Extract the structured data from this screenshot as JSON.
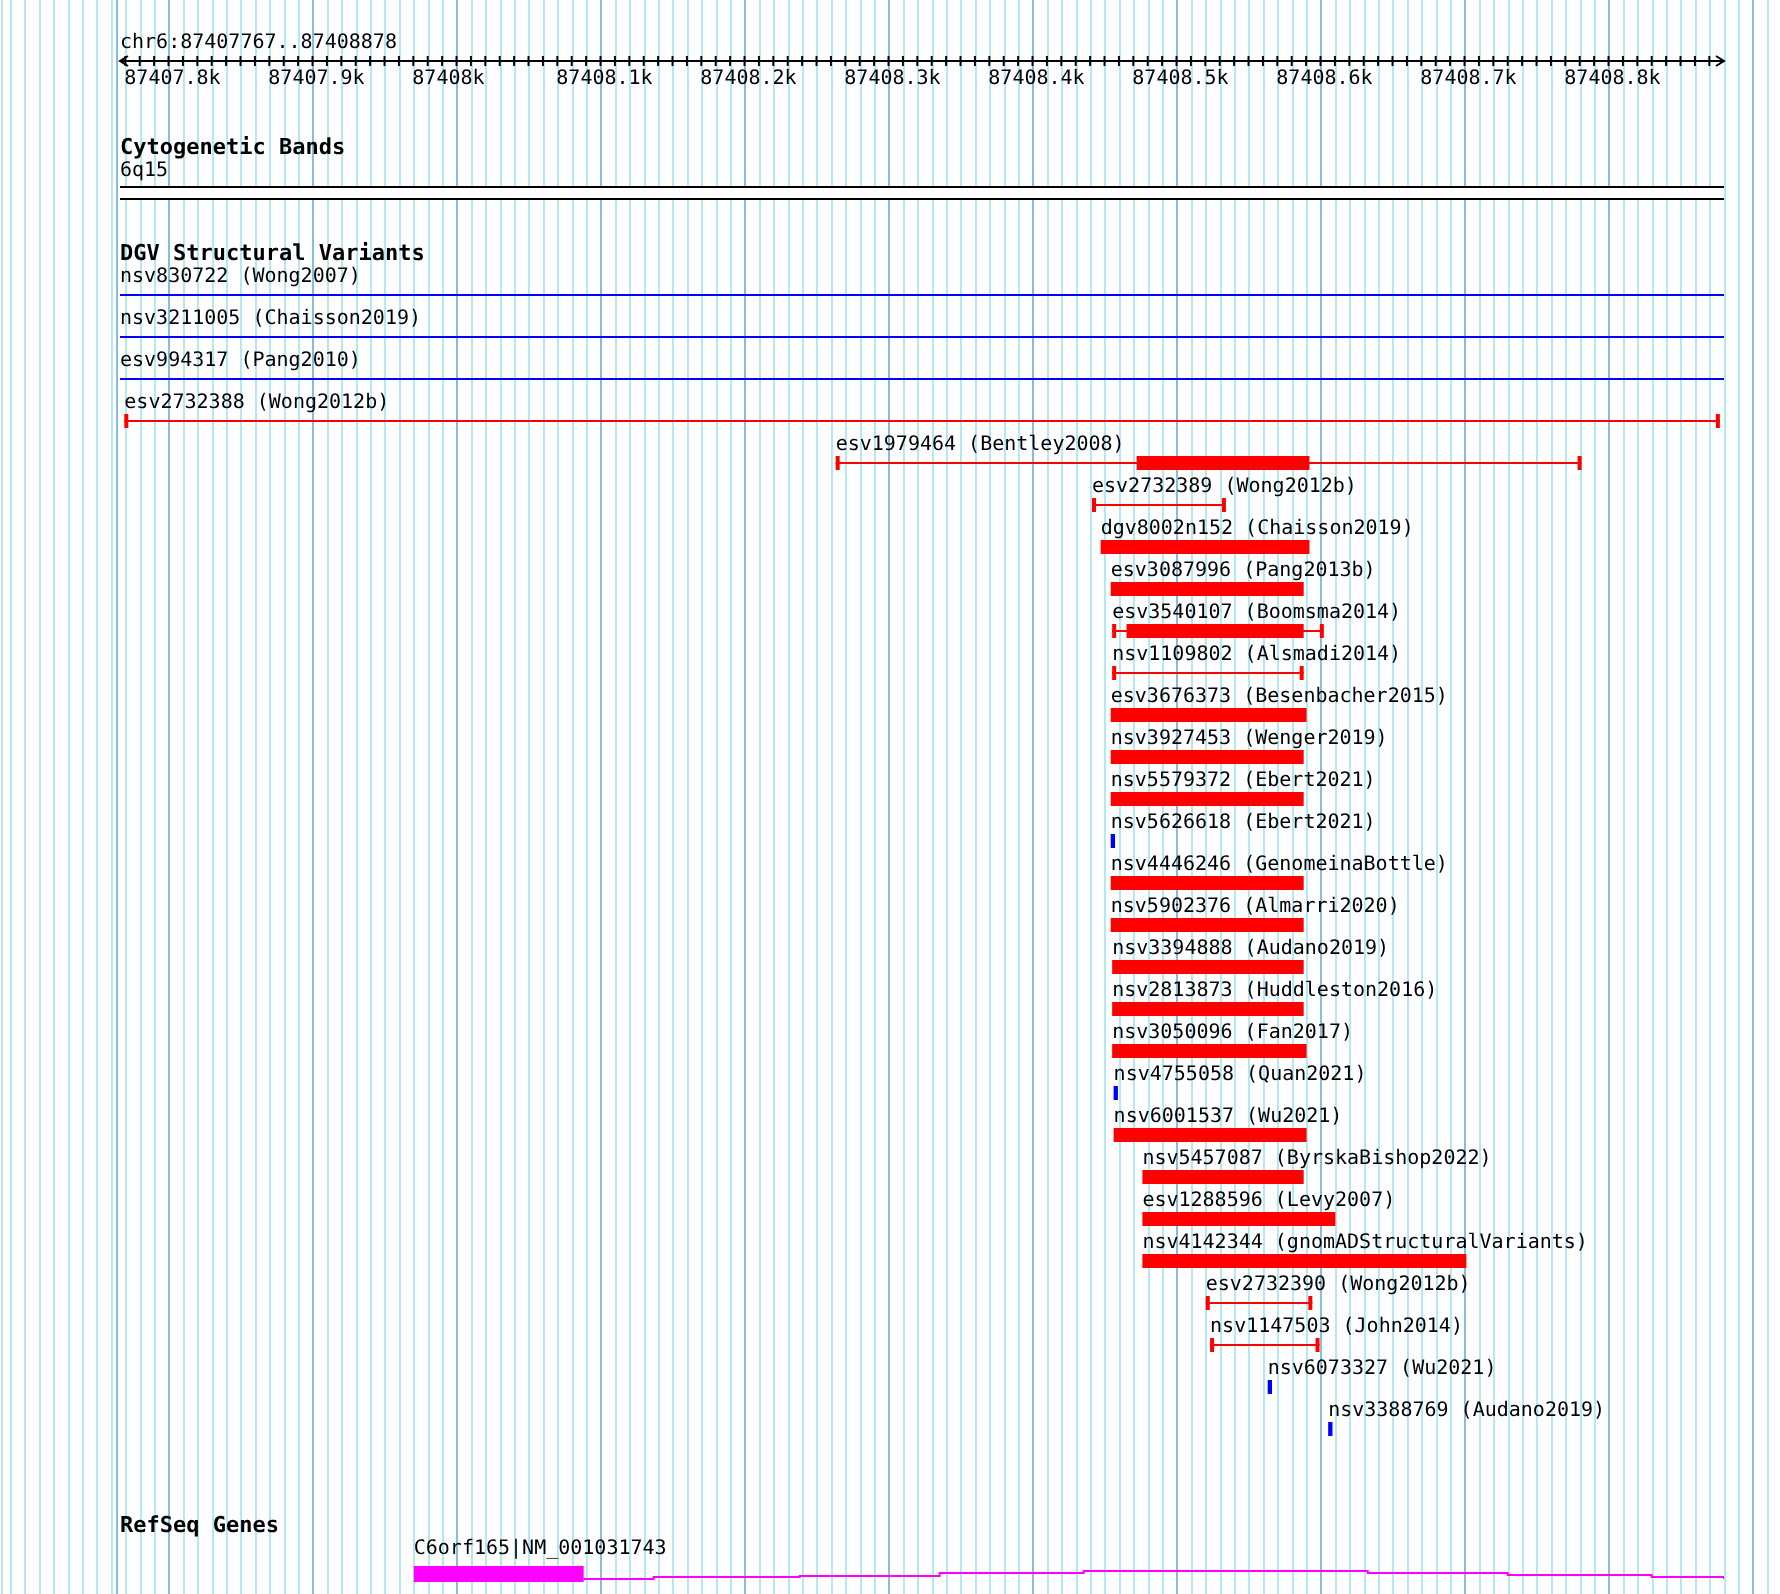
{
  "ruler": {
    "region": "chr6:87407767..87408878",
    "ticks": [
      "87407.8k",
      "87407.9k",
      "87408k",
      "87408.1k",
      "87408.2k",
      "87408.3k",
      "87408.4k",
      "87408.5k",
      "87408.6k",
      "87408.7k",
      "87408.8k"
    ]
  },
  "cytogenetic_bands": {
    "title": "Cytogenetic Bands",
    "band": "6q15"
  },
  "structural_variants": {
    "title": "DGV Structural Variants",
    "features": [
      {
        "label": "nsv830722 (Wong2007)",
        "kind": "line",
        "color": "#0000ff"
      },
      {
        "label": "nsv3211005 (Chaisson2019)",
        "kind": "line",
        "color": "#0000ff"
      },
      {
        "label": "esv994317 (Pang2010)",
        "kind": "line",
        "color": "#0000ff"
      },
      {
        "label": "esv2732388 (Wong2012b)",
        "kind": "capped",
        "color": "#ff0000"
      },
      {
        "label": "esv1979464 (Bentley2008)",
        "kind": "capped_bar",
        "color": "#ff0000"
      },
      {
        "label": "esv2732389 (Wong2012b)",
        "kind": "capped",
        "color": "#ff0000"
      },
      {
        "label": "dgv8002n152 (Chaisson2019)",
        "kind": "bar",
        "color": "#ff0000"
      },
      {
        "label": "esv3087996 (Pang2013b)",
        "kind": "bar",
        "color": "#ff0000"
      },
      {
        "label": "esv3540107 (Boomsma2014)",
        "kind": "capped_bar",
        "color": "#ff0000"
      },
      {
        "label": "nsv1109802 (Alsmadi2014)",
        "kind": "capped",
        "color": "#ff0000"
      },
      {
        "label": "esv3676373 (Besenbacher2015)",
        "kind": "bar",
        "color": "#ff0000"
      },
      {
        "label": "nsv3927453 (Wenger2019)",
        "kind": "bar",
        "color": "#ff0000"
      },
      {
        "label": "nsv5579372 (Ebert2021)",
        "kind": "bar",
        "color": "#ff0000"
      },
      {
        "label": "nsv5626618 (Ebert2021)",
        "kind": "point",
        "color": "#0000ff"
      },
      {
        "label": "nsv4446246 (GenomeinaBottle)",
        "kind": "bar",
        "color": "#ff0000"
      },
      {
        "label": "nsv5902376 (Almarri2020)",
        "kind": "bar",
        "color": "#ff0000"
      },
      {
        "label": "nsv3394888 (Audano2019)",
        "kind": "bar",
        "color": "#ff0000"
      },
      {
        "label": "nsv2813873 (Huddleston2016)",
        "kind": "bar",
        "color": "#ff0000"
      },
      {
        "label": "nsv3050096 (Fan2017)",
        "kind": "bar",
        "color": "#ff0000"
      },
      {
        "label": "nsv4755058 (Quan2021)",
        "kind": "point",
        "color": "#0000ff"
      },
      {
        "label": "nsv6001537 (Wu2021)",
        "kind": "bar",
        "color": "#ff0000"
      },
      {
        "label": "nsv5457087 (ByrskaBishop2022)",
        "kind": "bar",
        "color": "#ff0000"
      },
      {
        "label": "esv1288596 (Levy2007)",
        "kind": "bar",
        "color": "#ff0000"
      },
      {
        "label": "nsv4142344 (gnomADStructuralVariants)",
        "kind": "bar",
        "color": "#ff0000"
      },
      {
        "label": "esv2732390 (Wong2012b)",
        "kind": "capped",
        "color": "#ff0000"
      },
      {
        "label": "nsv1147503 (John2014)",
        "kind": "capped",
        "color": "#ff0000"
      },
      {
        "label": "nsv6073327 (Wu2021)",
        "kind": "point",
        "color": "#0000ff"
      },
      {
        "label": "nsv3388769 (Audano2019)",
        "kind": "point",
        "color": "#0000ff"
      }
    ]
  },
  "refseq_genes": {
    "title": "RefSeq Genes",
    "genes": [
      {
        "label": "C6orf165|NM_001031743",
        "color": "#ff00ff"
      }
    ]
  }
}
